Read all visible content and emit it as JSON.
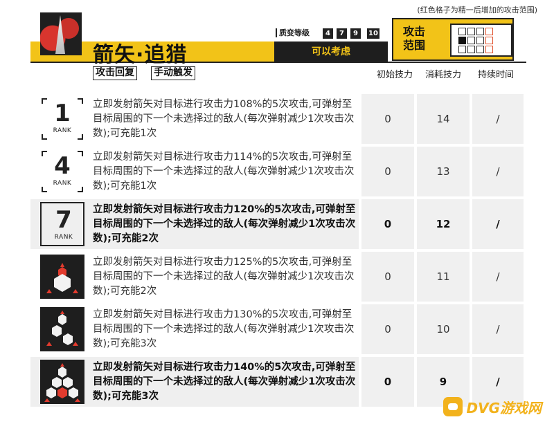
{
  "note": "(红色格子为精一后增加的攻击范围)",
  "skill": {
    "name": "箭矢·追猎",
    "status": "可以考虑",
    "potential_label": "质变等级",
    "potential_levels": [
      "4",
      "7",
      "9",
      "10"
    ],
    "range_label": "攻击范围",
    "tags": [
      "攻击回复",
      "手动触发"
    ]
  },
  "columns": [
    "初始技力",
    "消耗技力",
    "持续时间"
  ],
  "rows": [
    {
      "rank": "1",
      "rank_label": "RANK",
      "desc": "立即发射箭矢对目标进行攻击力108%的5次攻击,可弹射至目标周围的下一个未选择过的敌人(每次弹射减少1次攻击次数);可充能1次",
      "initial": "0",
      "cost": "14",
      "duration": "/"
    },
    {
      "rank": "4",
      "rank_label": "RANK",
      "desc": "立即发射箭矢对目标进行攻击力114%的5次攻击,可弹射至目标周围的下一个未选择过的敌人(每次弹射减少1次攻击次数);可充能1次",
      "initial": "0",
      "cost": "13",
      "duration": "/"
    },
    {
      "rank": "7",
      "rank_label": "RANK",
      "desc": "立即发射箭矢对目标进行攻击力120%的5次攻击,可弹射至目标周围的下一个未选择过的敌人(每次弹射减少1次攻击次数);可充能2次",
      "initial": "0",
      "cost": "12",
      "duration": "/"
    },
    {
      "rank": "M1",
      "desc": "立即发射箭矢对目标进行攻击力125%的5次攻击,可弹射至目标周围的下一个未选择过的敌人(每次弹射减少1次攻击次数);可充能2次",
      "initial": "0",
      "cost": "11",
      "duration": "/"
    },
    {
      "rank": "M2",
      "desc": "立即发射箭矢对目标进行攻击力130%的5次攻击,可弹射至目标周围的下一个未选择过的敌人(每次弹射减少1次攻击次数);可充能3次",
      "initial": "0",
      "cost": "10",
      "duration": "/"
    },
    {
      "rank": "M3",
      "desc": "立即发射箭矢对目标进行攻击力140%的5次攻击,可弹射至目标周围的下一个未选择过的敌人(每次弹射减少1次攻击次数);可充能3次",
      "initial": "0",
      "cost": "9",
      "duration": "/"
    }
  ],
  "watermark": "DVG游戏网",
  "colors": {
    "accent": "#f2c318",
    "dark": "#1e1e1e",
    "red": "#e0522e"
  }
}
